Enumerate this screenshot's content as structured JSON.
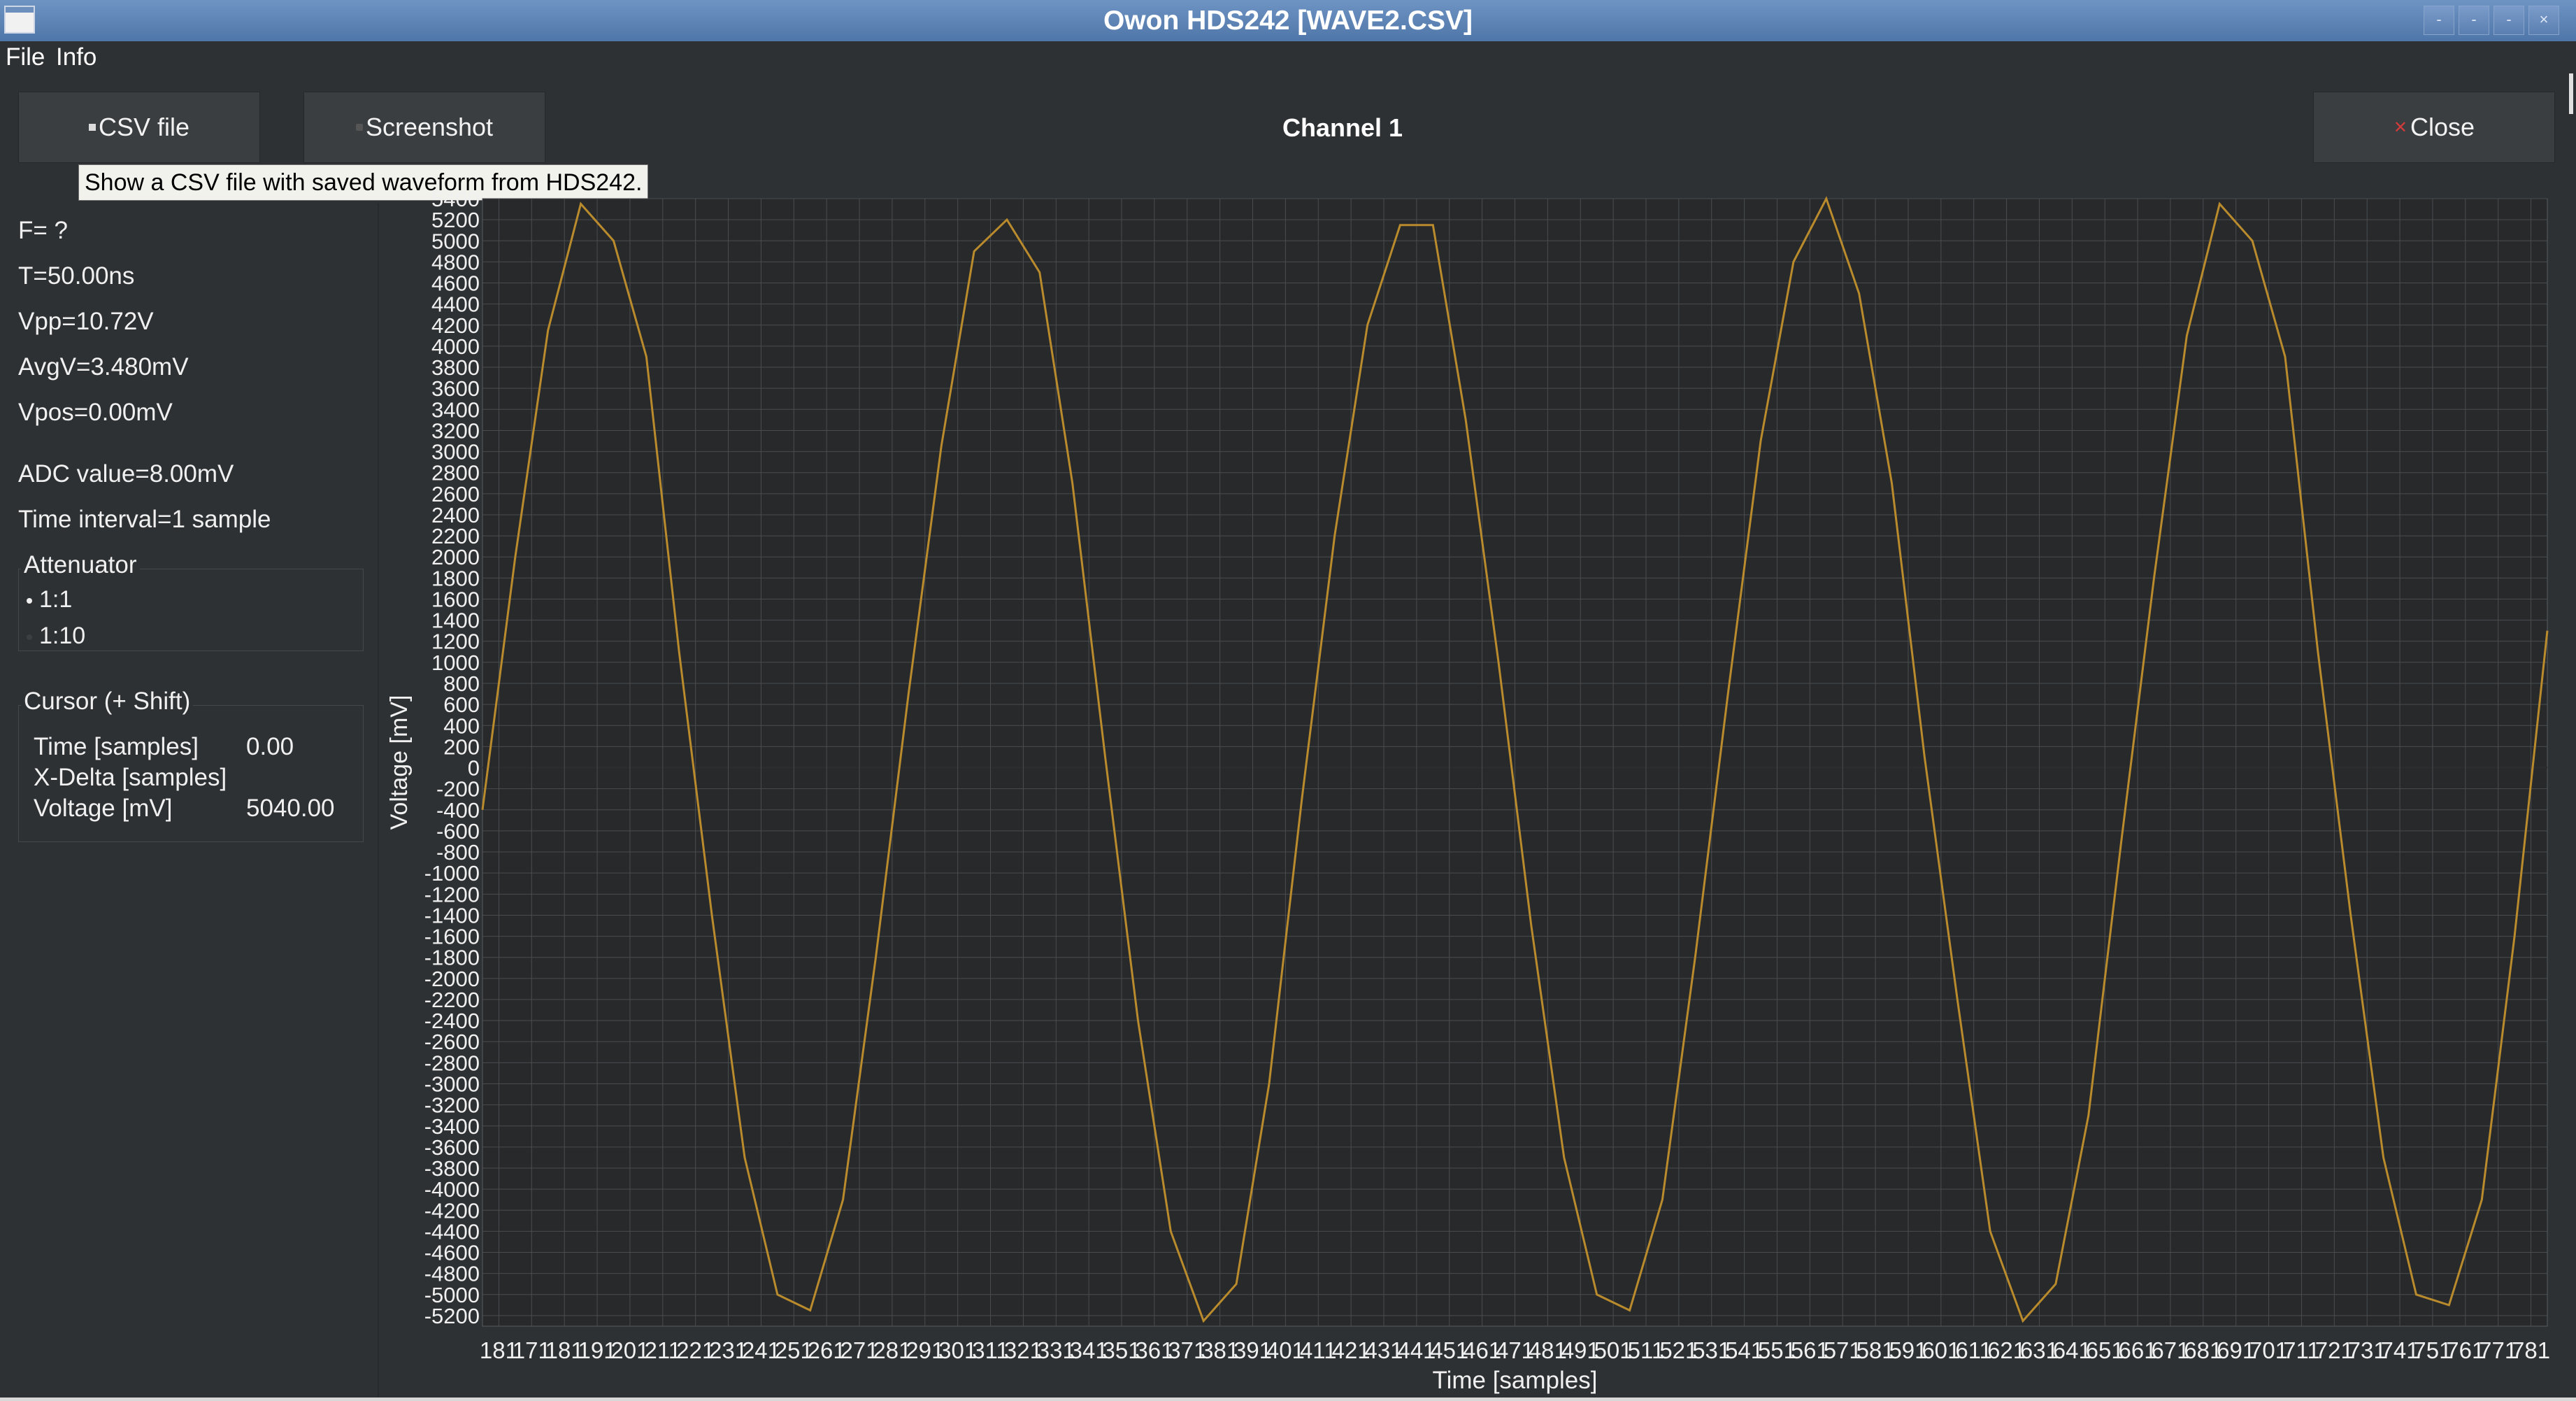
{
  "window": {
    "title": "Owon HDS242 [WAVE2.CSV]",
    "controls": [
      "-",
      "-",
      "-",
      "×"
    ]
  },
  "menu": {
    "file": "File",
    "info": "Info"
  },
  "toolbar": {
    "csv_label": "CSV file",
    "screenshot_label": "Screenshot",
    "close_label": "Close",
    "channel_title": "Channel 1",
    "tooltip": "Show a CSV file with saved waveform from HDS242."
  },
  "measurements": {
    "frequency": "F=  ?",
    "period": "T=50.00ns",
    "vpp": "Vpp=10.72V",
    "avgv": "AvgV=3.480mV",
    "vpos": "Vpos=0.00mV",
    "adc": "ADC value=8.00mV",
    "interval": "Time interval=1 sample"
  },
  "attenuator": {
    "title": "Attenuator",
    "options": [
      "1:1",
      "1:10"
    ],
    "selected": "1:1"
  },
  "cursor": {
    "title": "Cursor (+ Shift)",
    "rows": [
      {
        "label": "Time [samples]",
        "value": "0.00"
      },
      {
        "label": "X-Delta [samples]",
        "value": ""
      },
      {
        "label": "Voltage [mV]",
        "value": "5040.00"
      }
    ]
  },
  "colors": {
    "background": "#2e3133",
    "plot_background": "#27292b",
    "grid": "#4a4d50",
    "trace": "#b98b2c",
    "titlebar": "#5a80b3"
  },
  "chart_data": {
    "type": "line",
    "title": "",
    "xlabel": "Time [samples]",
    "ylabel": "Voltage [mV]",
    "xlim": [
      0,
      63
    ],
    "ylim": [
      -5300,
      5400
    ],
    "grid": true,
    "y_tick_step": 200,
    "x_tick_labels": [
      "181",
      "171",
      "181",
      "191",
      "201",
      "211",
      "221",
      "231",
      "241",
      "251",
      "261",
      "271",
      "281",
      "291",
      "301",
      "311",
      "321",
      "331",
      "341",
      "351",
      "361",
      "371",
      "381",
      "391",
      "401",
      "411",
      "421",
      "431",
      "441",
      "451",
      "461",
      "471",
      "481",
      "491",
      "501",
      "511",
      "521",
      "531",
      "541",
      "551",
      "561",
      "571",
      "581",
      "591",
      "601",
      "611",
      "621",
      "631",
      "641",
      "651",
      "661",
      "671",
      "681",
      "691",
      "701",
      "711",
      "721",
      "731",
      "741",
      "751",
      "761",
      "771",
      "781"
    ],
    "series": [
      {
        "x": [
          0,
          1,
          2,
          3,
          4,
          5,
          6,
          7,
          8,
          9,
          10,
          11,
          12,
          13,
          14,
          15,
          16,
          17,
          18,
          19,
          20,
          21,
          22,
          23,
          24,
          25,
          26,
          27,
          28,
          29,
          30,
          31,
          32,
          33,
          34,
          35,
          36,
          37,
          38,
          39,
          40,
          41,
          42,
          43,
          44,
          45,
          46,
          47,
          48,
          49,
          50,
          51,
          52,
          53,
          54,
          55,
          56,
          57,
          58,
          59,
          60,
          61,
          62,
          63
        ],
        "values": [
          -400,
          2000,
          4150,
          5350,
          5000,
          3900,
          1100,
          -1400,
          -3700,
          -5000,
          -5150,
          -4100,
          -1800,
          700,
          3050,
          4900,
          5200,
          4700,
          2700,
          100,
          -2400,
          -4400,
          -5250,
          -4900,
          -3000,
          -300,
          2200,
          4200,
          5150,
          5150,
          3300,
          1000,
          -1500,
          -3700,
          -5000,
          -5150,
          -4100,
          -1800,
          700,
          3100,
          4800,
          5400,
          4500,
          2700,
          100,
          -2200,
          -4400,
          -5250,
          -4900,
          -3300,
          -700,
          1800,
          4100,
          5350,
          5000,
          3900,
          1100,
          -1400,
          -3700,
          -5000,
          -5100,
          -4100,
          -1600,
          1300
        ]
      }
    ]
  }
}
